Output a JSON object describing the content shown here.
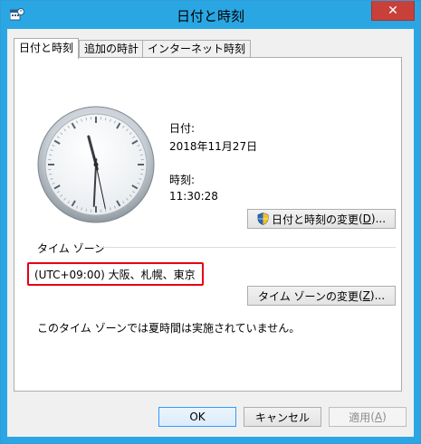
{
  "window": {
    "title": "日付と時刻",
    "close_label": "✕"
  },
  "tabs": [
    {
      "label": "日付と時刻",
      "active": true
    },
    {
      "label": "追加の時計",
      "active": false
    },
    {
      "label": "インターネット時刻",
      "active": false
    }
  ],
  "datetime": {
    "date_label": "日付:",
    "date_value": "2018年11月27日",
    "time_label": "時刻:",
    "time_value": "11:30:28",
    "change_datetime_button": "日付と時刻の変更",
    "change_datetime_accel": "D"
  },
  "timezone": {
    "group_label": "タイム ゾーン",
    "value": "(UTC+09:00) 大阪、札幌、東京",
    "change_button": "タイム ゾーンの変更",
    "change_accel": "Z",
    "dst_note": "このタイム ゾーンでは夏時間は実施されていません。"
  },
  "footer": {
    "ok": "OK",
    "cancel": "キャンセル",
    "apply": "適用",
    "apply_accel": "A"
  },
  "clock": {
    "hours": 11,
    "minutes": 30,
    "seconds": 28
  },
  "colors": {
    "titlebar": "#2aa7e3",
    "close": "#c7413a",
    "highlight": "#e60012"
  }
}
